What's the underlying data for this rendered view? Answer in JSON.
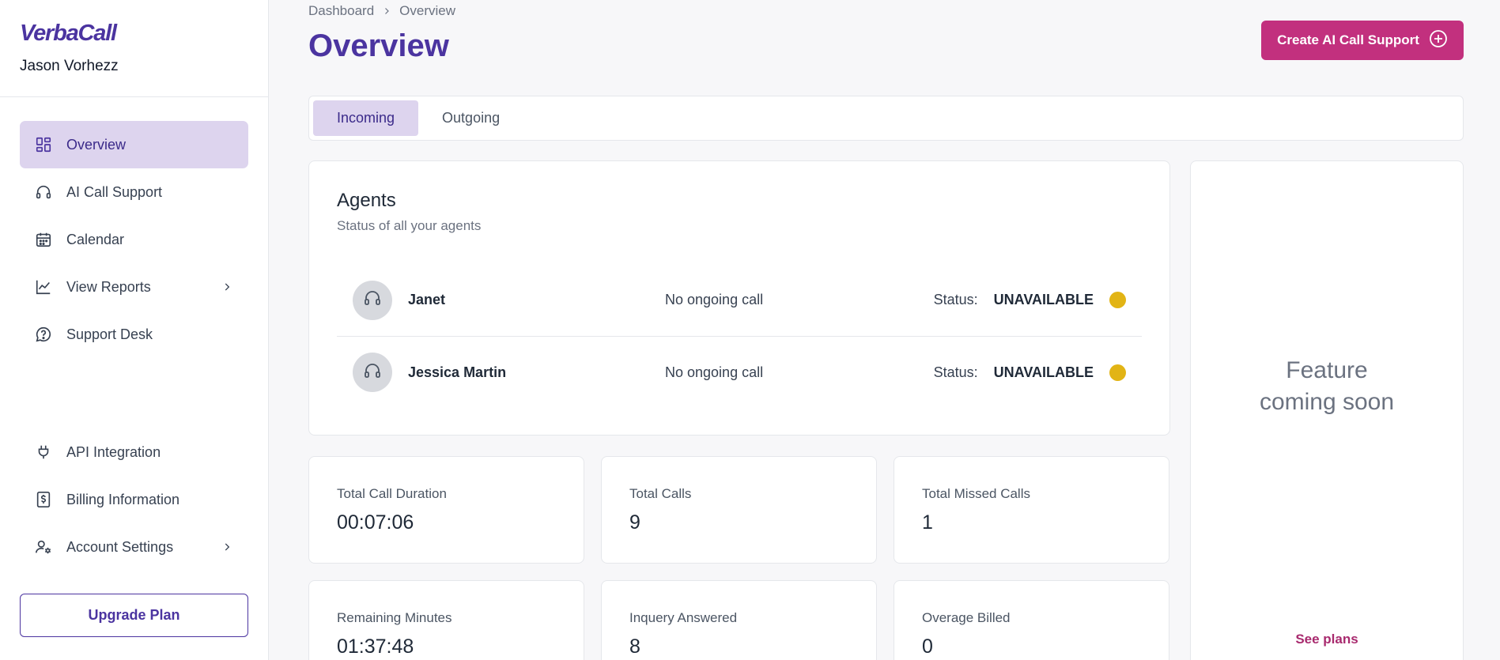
{
  "brand": {
    "logo": "VerbaCall",
    "user_name": "Jason Vorhezz"
  },
  "sidebar": {
    "items": [
      {
        "label": "Overview",
        "icon": "dashboard-icon",
        "active": true
      },
      {
        "label": "AI Call Support",
        "icon": "headset-icon"
      },
      {
        "label": "Calendar",
        "icon": "calendar-icon"
      },
      {
        "label": "View Reports",
        "icon": "chart-line-icon",
        "has_submenu": true
      },
      {
        "label": "Support Desk",
        "icon": "help-bubble-icon"
      }
    ],
    "bottom_items": [
      {
        "label": "API Integration",
        "icon": "plug-icon"
      },
      {
        "label": "Billing Information",
        "icon": "billing-icon"
      },
      {
        "label": "Account Settings",
        "icon": "user-settings-icon",
        "has_submenu": true
      }
    ],
    "upgrade_label": "Upgrade Plan"
  },
  "breadcrumb": {
    "items": [
      "Dashboard",
      "Overview"
    ]
  },
  "page": {
    "title": "Overview",
    "create_button": "Create AI Call Support"
  },
  "tabs": [
    {
      "label": "Incoming",
      "active": true
    },
    {
      "label": "Outgoing"
    }
  ],
  "agents": {
    "title": "Agents",
    "subtitle": "Status of all your agents",
    "list": [
      {
        "name": "Janet",
        "call_status": "No ongoing call",
        "status_label": "Status:",
        "status": "UNAVAILABLE"
      },
      {
        "name": "Jessica Martin",
        "call_status": "No ongoing call",
        "status_label": "Status:",
        "status": "UNAVAILABLE"
      }
    ]
  },
  "stats": [
    {
      "label": "Total Call Duration",
      "value": "00:07:06"
    },
    {
      "label": "Total Calls",
      "value": "9"
    },
    {
      "label": "Total Missed Calls",
      "value": "1"
    },
    {
      "label": "Remaining Minutes",
      "value": "01:37:48"
    },
    {
      "label": "Inquery Answered",
      "value": "8"
    },
    {
      "label": "Overage Billed",
      "value": "0"
    }
  ],
  "feature": {
    "text": "Feature coming soon",
    "link": "See plans"
  },
  "colors": {
    "brand": "#4b34a0",
    "accent": "#c2307e",
    "active_bg": "#ddd4ee",
    "status_unavailable": "#e2b415"
  }
}
